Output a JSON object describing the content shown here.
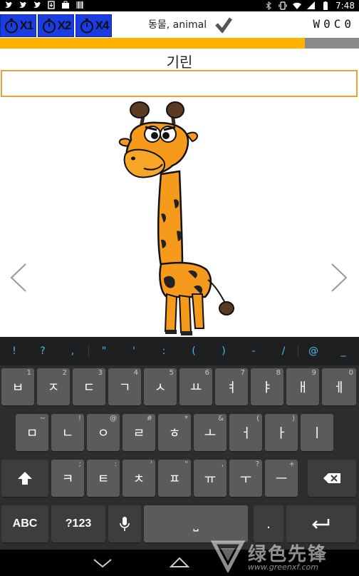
{
  "status_bar": {
    "time": "7:48",
    "left_icons": [
      "twitter-icon",
      "twitter-icon",
      "twitter-icon",
      "download-icon",
      "briefcase-icon",
      "barcode-icon"
    ],
    "right_icons": [
      "bluetooth-icon",
      "vibrate-icon",
      "wifi-icon",
      "signal-icon",
      "battery-icon"
    ]
  },
  "toolbar": {
    "timers": [
      {
        "label": "X1"
      },
      {
        "label": "X2"
      },
      {
        "label": "X4"
      }
    ],
    "category": "동물, animal",
    "score": "W0C0"
  },
  "progress": {
    "value_percent": 85,
    "color": "#ffb300",
    "track_color": "#8a8a8a"
  },
  "quiz": {
    "word": "기린",
    "answer_value": "",
    "image": "giraffe-cartoon"
  },
  "keyboard": {
    "suggestions": [
      "!",
      "?",
      ",",
      "\"",
      "'",
      ":",
      "(",
      ")",
      "-",
      "/",
      "@",
      "_"
    ],
    "row1": [
      {
        "label": "ㅂ",
        "hint": "1"
      },
      {
        "label": "ㅈ",
        "hint": "2"
      },
      {
        "label": "ㄷ",
        "hint": "3"
      },
      {
        "label": "ㄱ",
        "hint": "4"
      },
      {
        "label": "ㅅ",
        "hint": "5"
      },
      {
        "label": "ㅛ",
        "hint": "6"
      },
      {
        "label": "ㅕ",
        "hint": "7"
      },
      {
        "label": "ㅑ",
        "hint": "8"
      },
      {
        "label": "ㅐ",
        "hint": "9"
      },
      {
        "label": "ㅔ",
        "hint": "0"
      }
    ],
    "row2": [
      {
        "label": "ㅁ",
        "hint": "~"
      },
      {
        "label": "ㄴ",
        "hint": "!"
      },
      {
        "label": "ㅇ",
        "hint": "@"
      },
      {
        "label": "ㄹ",
        "hint": "#"
      },
      {
        "label": "ㅎ",
        "hint": "*"
      },
      {
        "label": "ㅗ",
        "hint": "&"
      },
      {
        "label": "ㅓ",
        "hint": "("
      },
      {
        "label": "ㅏ",
        "hint": ")"
      },
      {
        "label": "ㅣ",
        "hint": ""
      }
    ],
    "row3": [
      {
        "label": "ㅋ",
        "hint": ";"
      },
      {
        "label": "ㅌ",
        "hint": ":"
      },
      {
        "label": "ㅊ",
        "hint": "'"
      },
      {
        "label": "ㅍ",
        "hint": "\""
      },
      {
        "label": "ㅠ",
        "hint": ","
      },
      {
        "label": "ㅜ",
        "hint": "?"
      },
      {
        "label": "ㅡ",
        "hint": "+"
      }
    ],
    "abc_label": "ABC",
    "num_label": "?123",
    "period_label": ".",
    "space_label": "⎵"
  },
  "watermark": {
    "text": "绿色先锋",
    "url": "www.greenxf.com"
  }
}
